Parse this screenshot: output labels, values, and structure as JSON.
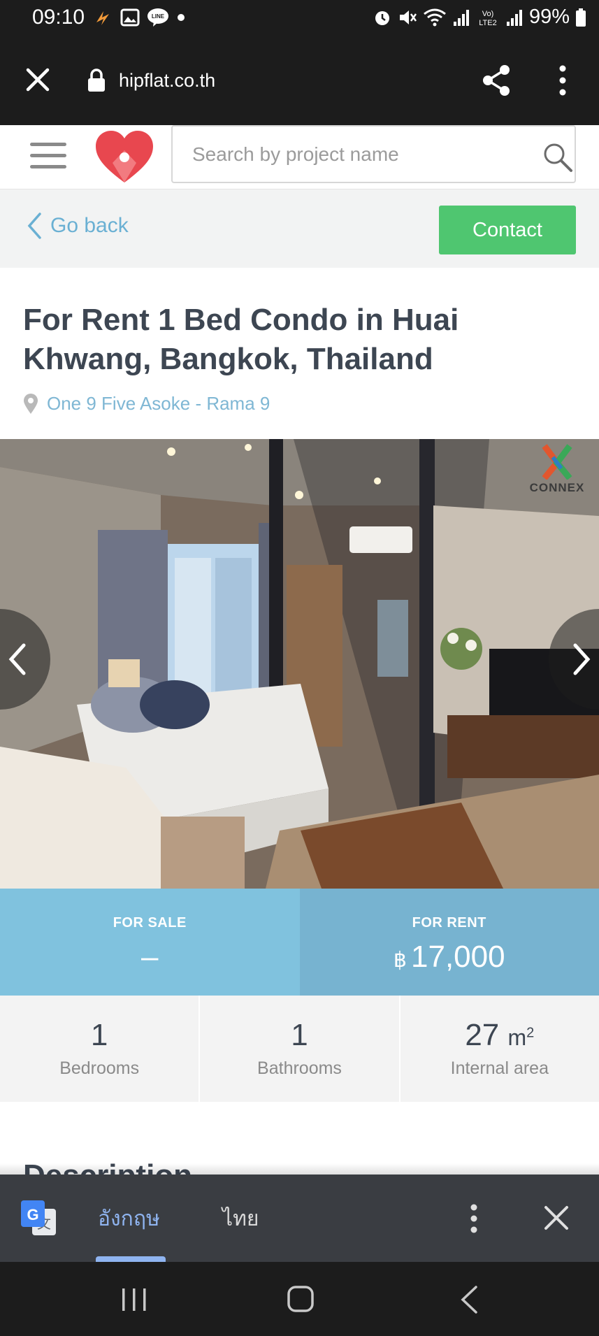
{
  "status_bar": {
    "time": "09:10",
    "battery": "99%",
    "left_icons": [
      "flash-app-icon",
      "gallery-icon",
      "line-icon",
      "dot-icon"
    ],
    "right_icons": [
      "alarm-icon",
      "mute-icon",
      "wifi-icon",
      "signal-icon",
      "volte-icon",
      "signal-icon",
      "battery-icon"
    ]
  },
  "browser": {
    "url": "hipflat.co.th"
  },
  "header": {
    "search_placeholder": "Search by project name"
  },
  "subnav": {
    "back_label": "Go back",
    "contact_label": "Contact"
  },
  "listing": {
    "title": "For Rent 1 Bed Condo in Huai Khwang, Bangkok, Thailand",
    "project": "One 9 Five Asoke - Rama 9",
    "watermark": "CONNEX"
  },
  "prices": {
    "sale_label": "FOR SALE",
    "sale_value": "–",
    "rent_label": "FOR RENT",
    "currency": "฿",
    "rent_value": "17,000"
  },
  "stats": {
    "bedrooms_value": "1",
    "bedrooms_label": "Bedrooms",
    "bathrooms_value": "1",
    "bathrooms_label": "Bathrooms",
    "area_value": "27",
    "area_unit": "m",
    "area_unit_sup": "2",
    "area_label": "Internal area"
  },
  "description": {
    "heading": "Description"
  },
  "translate": {
    "lang_source": "อังกฤษ",
    "lang_target": "ไทย"
  },
  "colors": {
    "accent_blue": "#6ab0d3",
    "contact_green": "#4fc670",
    "sale_bg": "#80c2de",
    "rent_bg": "#77b3d0",
    "logo_red": "#e8474f"
  }
}
